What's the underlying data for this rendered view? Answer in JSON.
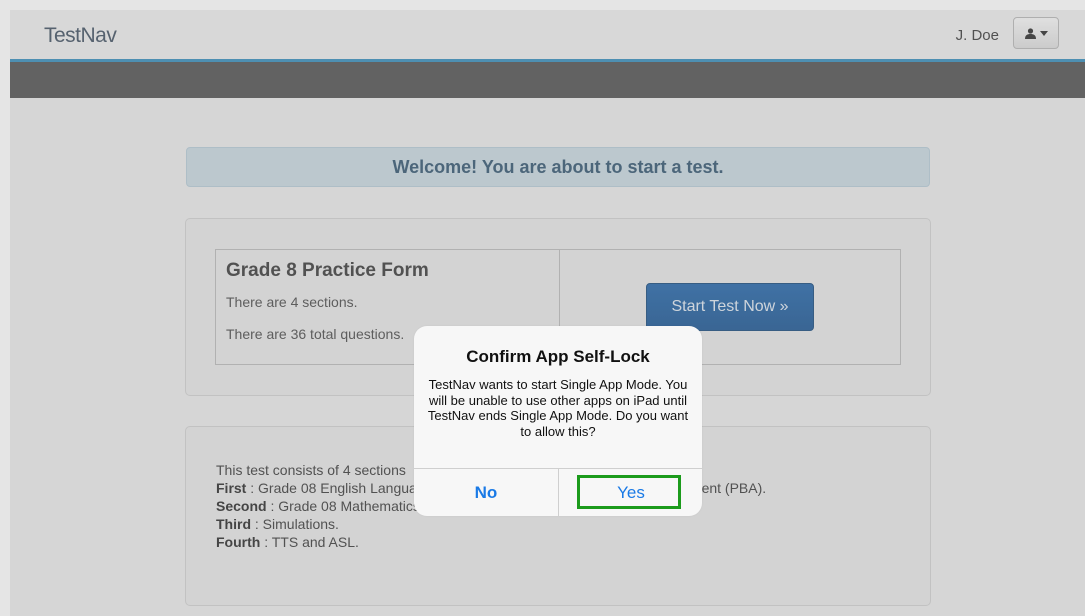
{
  "header": {
    "logo": "TestNav",
    "username": "J. Doe",
    "user_menu_icon": "user-icon"
  },
  "welcome": {
    "message": "Welcome! You are about to start a test."
  },
  "test_form": {
    "title": "Grade 8 Practice Form",
    "sections_text": "There are 4 sections.",
    "questions_text": "There are 36 total questions.",
    "start_button": "Start Test Now »"
  },
  "info": {
    "intro": "This test consists of 4 sections",
    "lines": [
      {
        "label": "First",
        "text": " : Grade 08 English Language Arts/Literacy Performance-Based Assessment (PBA)."
      },
      {
        "label": "Second",
        "text": " : Grade 08 Mathematics"
      },
      {
        "label": "Third",
        "text": " : Simulations."
      },
      {
        "label": "Fourth",
        "text": " : TTS and ASL."
      }
    ]
  },
  "dialog": {
    "title": "Confirm App Self-Lock",
    "message": "TestNav wants to start Single App Mode. You will be unable to use other apps on iPad until TestNav ends Single App Mode. Do you want to allow this?",
    "no_label": "No",
    "yes_label": "Yes"
  },
  "colors": {
    "accent_line": "#2d88b9",
    "start_button": "#1a5fa6",
    "dialog_button_text": "#1a7ae6",
    "highlight": "#1c9b1c"
  }
}
